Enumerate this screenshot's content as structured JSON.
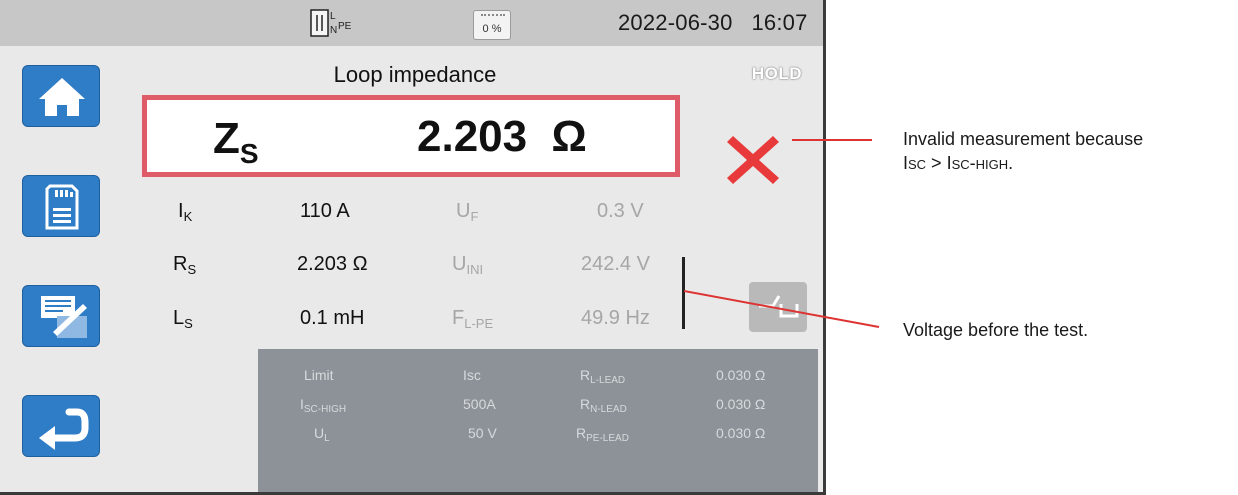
{
  "status_bar": {
    "connection_icon": "L-N-PE-icon",
    "battery_percent": "0 %",
    "date": "2022-06-30",
    "time": "16:07"
  },
  "sidebar": {
    "items": [
      {
        "name": "home",
        "icon": "home-icon"
      },
      {
        "name": "memory",
        "icon": "sd-card-icon"
      },
      {
        "name": "report",
        "icon": "notepad-icon"
      },
      {
        "name": "back",
        "icon": "back-arrow-icon"
      }
    ]
  },
  "screen": {
    "title": "Loop impedance",
    "hold_label": "HOLD"
  },
  "main_measurement": {
    "symbol": "Z",
    "subscript": "S",
    "value": "2.203  Ω",
    "status_icon": "invalid-x-icon"
  },
  "measurements": [
    {
      "label": "I",
      "sub": "K",
      "value": "110 A"
    },
    {
      "label": "R",
      "sub": "S",
      "value": "2.203 Ω"
    },
    {
      "label": "L",
      "sub": "S",
      "value": "0.1 mH"
    }
  ],
  "voltages": [
    {
      "label": "U",
      "sub": "F",
      "value": "0.3 V"
    },
    {
      "label": "U",
      "sub": "INI",
      "value": "242.4 V"
    },
    {
      "label": "F",
      "sub": "L-PE",
      "value": "49.9 Hz"
    }
  ],
  "limits": {
    "rows": [
      {
        "k1": "Limit",
        "k1sub": "",
        "v1": "Isc",
        "k2": "R",
        "k2sub": "L-LEAD",
        "v2": "0.030 Ω"
      },
      {
        "k1": "I",
        "k1sub": "SC-HIGH",
        "v1": "500A",
        "k2": "R",
        "k2sub": "N-LEAD",
        "v2": "0.030 Ω"
      },
      {
        "k1": "U",
        "k1sub": "L",
        "v1": "50 V",
        "k2": "R",
        "k2sub": "PE-LEAD",
        "v2": "0.030 Ω"
      }
    ]
  },
  "callouts": {
    "invalid_line1": "Invalid measurement because",
    "invalid_line2": "Isc > Isc-high.",
    "voltage": "Voltage before the test."
  },
  "colors": {
    "accent_blue": "#2f7dc7",
    "alert_red": "#de5b67",
    "x_red": "#e83a3a"
  }
}
